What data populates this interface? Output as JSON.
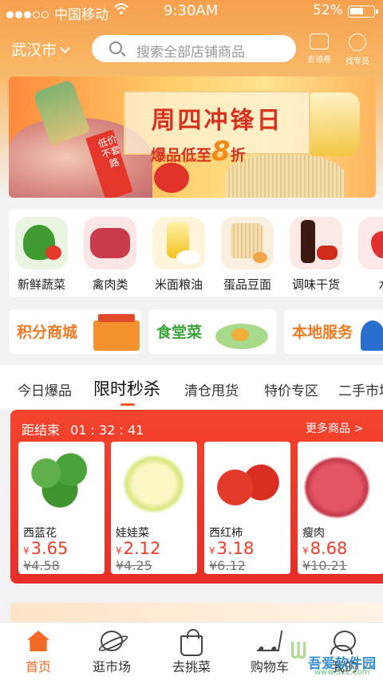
{
  "status_bar": {
    "carrier": "中国移动",
    "time": "9:30AM",
    "battery": "52%"
  },
  "header": {
    "city": "武汉市",
    "search_placeholder": "搜索全部店铺商品",
    "coupon_label": "去领卷",
    "staff_label": "找专员"
  },
  "banner": {
    "title": "周四冲锋日",
    "subtitle_prefix": "爆品低至",
    "subtitle_number": "8",
    "subtitle_suffix": "折",
    "tag": "低价不套路"
  },
  "categories": [
    {
      "label": "新鲜蔬菜"
    },
    {
      "label": "禽肉类"
    },
    {
      "label": "米面粮油"
    },
    {
      "label": "蛋品豆面"
    },
    {
      "label": "调味干货"
    },
    {
      "label": "水"
    }
  ],
  "promos": [
    {
      "label": "积分商城"
    },
    {
      "label": "食堂菜"
    },
    {
      "label": "本地服务"
    }
  ],
  "tabs": [
    {
      "label": "今日爆品"
    },
    {
      "label": "限时秒杀"
    },
    {
      "label": "清仓甩货"
    },
    {
      "label": "特价专区"
    },
    {
      "label": "二手市场"
    }
  ],
  "flash_sale": {
    "countdown_label": "距结束",
    "countdown": "01 : 32 : 41",
    "more": "更多商品 >",
    "currency": "¥",
    "products": [
      {
        "name": "西蓝花",
        "price": "3.65",
        "old_price": "¥4.58"
      },
      {
        "name": "娃娃菜",
        "price": "2.12",
        "old_price": "¥4.25"
      },
      {
        "name": "西红柿",
        "price": "3.18",
        "old_price": "¥6.12"
      },
      {
        "name": "瘦肉",
        "price": "8.68",
        "old_price": "¥10.21"
      }
    ]
  },
  "bottom_nav": [
    {
      "label": "首页"
    },
    {
      "label": "逛市场"
    },
    {
      "label": "去挑菜"
    },
    {
      "label": "购物车"
    },
    {
      "label": "我的"
    }
  ],
  "watermark": {
    "line1": "吾爱软件园",
    "line2": "www.52z.com"
  },
  "colors": {
    "accent": "#f26a25",
    "sale_red": "#f03a2b",
    "header_orange": "#f6a04e"
  }
}
